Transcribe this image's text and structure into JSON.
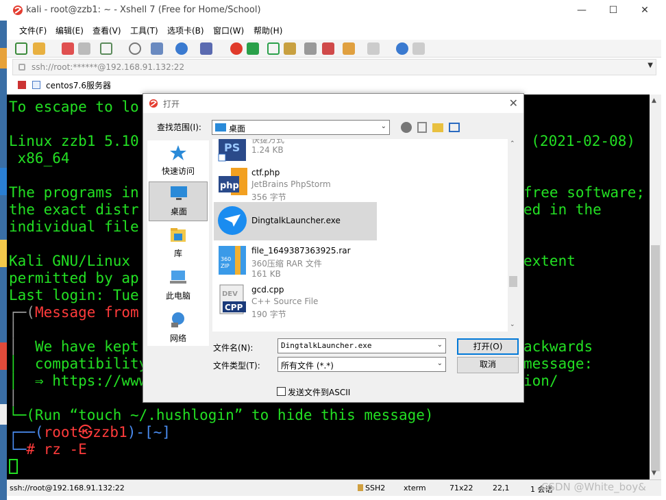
{
  "window": {
    "title": "kali - root@zzb1: ~ - Xshell 7 (Free for Home/School)",
    "minimize": "—",
    "maximize": "☐",
    "close": "✕"
  },
  "menu": [
    "文件(F)",
    "编辑(E)",
    "查看(V)",
    "工具(T)",
    "选项卡(B)",
    "窗口(W)",
    "帮助(H)"
  ],
  "address": {
    "text": "ssh://root:******@192.168.91.132:22"
  },
  "session_tab": {
    "label": "centos7.6服务器"
  },
  "terminal": {
    "l1": "To escape to lo",
    "l2": "Linux zzb1 5.10",
    "l2r": ". (2021-02-08)",
    "l3": " x86_64",
    "l4": "The programs in",
    "l4r": "free software;",
    "l5": "the exact distr",
    "l5r": "ed in the",
    "l6": "individual file",
    "l7": "Kali GNU/Linux ",
    "l7r": "extent",
    "l8": "permitted by ap",
    "l9": "Last login: Tue",
    "l10a": "┌─(",
    "l10b": "Message from",
    "l11": "│",
    "l12a": "│  ",
    "l12b": "We have kept ",
    "l12r": "ackwards",
    "l13": "│  compatibility",
    "l13r": "message:",
    "l14": "│  ⇒ https://www",
    "l14r": "ion/",
    "l15": "│",
    "l16": "└─(Run “touch ~/.hushlogin” to hide this message)",
    "p1a": "┌──(",
    "p1b": "root㉿zzb1",
    "p1c": ")-[",
    "p1d": "~",
    "p1e": "]",
    "p2a": "└─",
    "p2b": "# ",
    "p2c": "rz -E"
  },
  "status": {
    "conn": "ssh://root@192.168.91.132:22",
    "proto": "SSH2",
    "term": "xterm",
    "size": "71x22",
    "pos": "22,1",
    "sessions": "1 会话",
    "watermark": "CSDN @White_boy&"
  },
  "dialog": {
    "title": "打开",
    "close": "✕",
    "look_in_label": "查找范围(I):",
    "look_in_value": "桌面",
    "places": [
      {
        "label": "快速访问"
      },
      {
        "label": "桌面"
      },
      {
        "label": "库"
      },
      {
        "label": "此电脑"
      },
      {
        "label": "网络"
      }
    ],
    "files": [
      {
        "name": "",
        "type": "快捷方式",
        "size": "1.24 KB"
      },
      {
        "name": "ctf.php",
        "type": "JetBrains PhpStorm",
        "size": "356 字节"
      },
      {
        "name": "DingtalkLauncher.exe",
        "type": "",
        "size": ""
      },
      {
        "name": "file_1649387363925.rar",
        "type": "360压缩 RAR 文件",
        "size": "161 KB"
      },
      {
        "name": "gcd.cpp",
        "type": "C++ Source File",
        "size": "190 字节"
      }
    ],
    "filename_label": "文件名(N):",
    "filename_value": "DingtalkLauncher.exe",
    "filetype_label": "文件类型(T):",
    "filetype_value": "所有文件 (*.*)",
    "open_btn": "打开(O)",
    "cancel_btn": "取消",
    "ascii_label": "发送文件到ASCII"
  },
  "colors": {
    "terminal_bg": "#000000",
    "terminal_fg": "#23e023",
    "accent_red": "#ff3b3b",
    "accent_blue": "#4a8cf0"
  }
}
